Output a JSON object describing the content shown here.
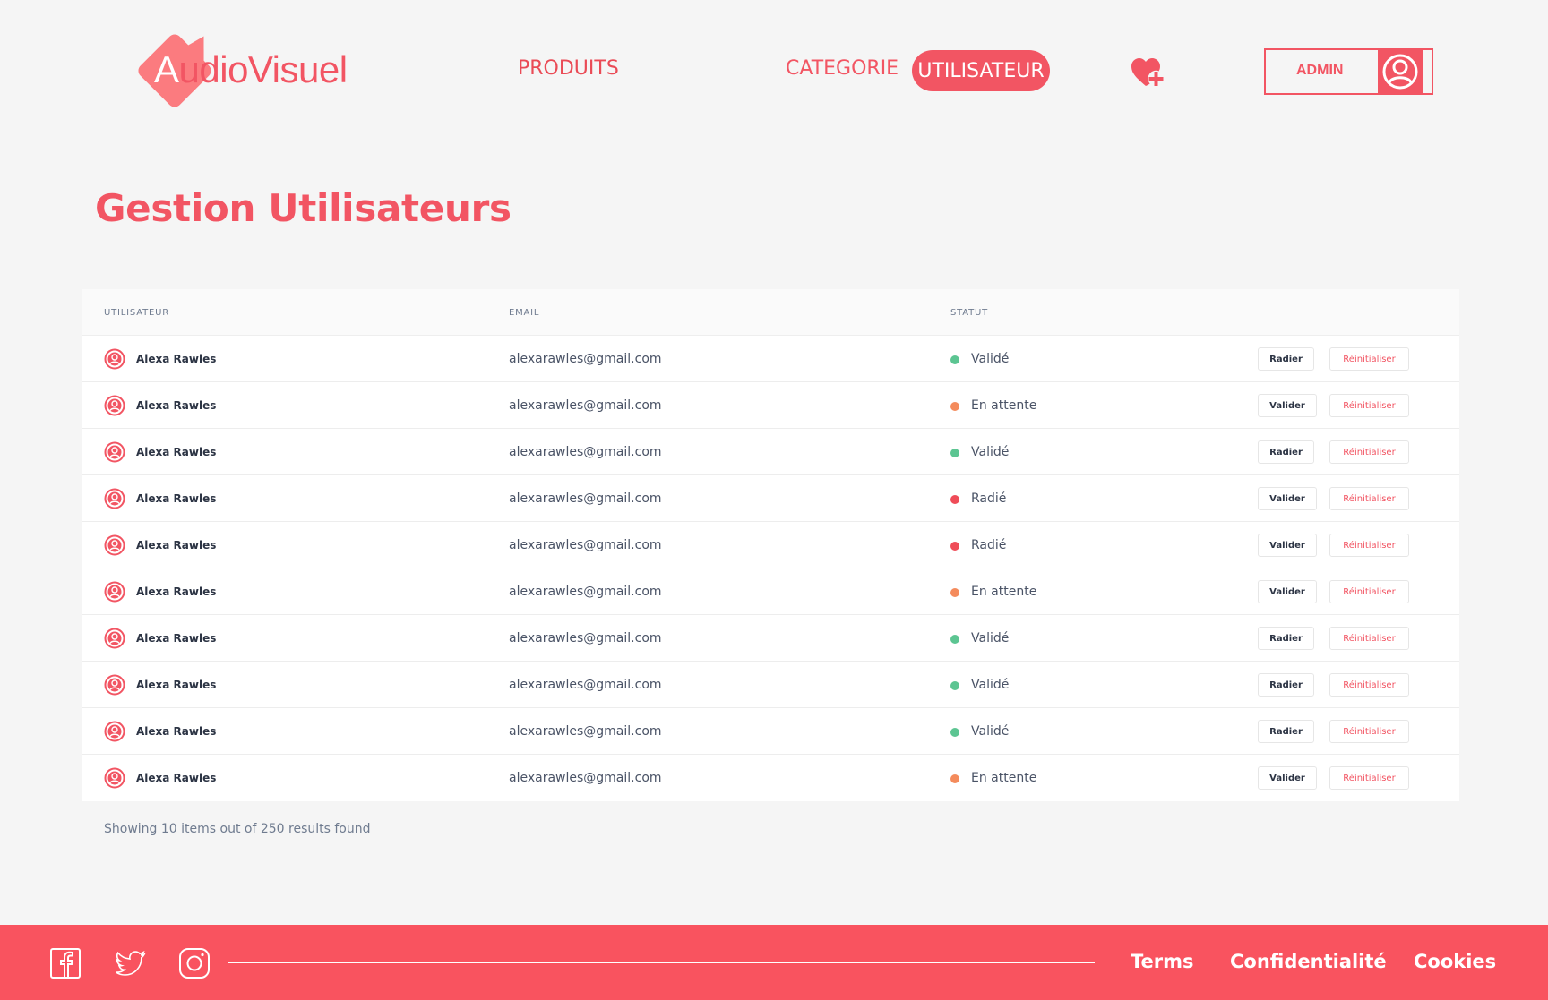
{
  "brand": {
    "logo_first": "A",
    "logo_rest": "udioVisuel"
  },
  "nav": {
    "produits": "PRODUITS",
    "categorie": "CATEGORIE",
    "utilisateur": "UTILISATEUR"
  },
  "header": {
    "favorite_icon": "heart-plus-icon",
    "admin_label": "ADMIN",
    "avatar_icon": "user-circle-icon"
  },
  "page": {
    "title": "Gestion Utilisateurs"
  },
  "table": {
    "columns": {
      "user": "UTILISATEUR",
      "email": "EMAIL",
      "status": "STATUT"
    },
    "rows": [
      {
        "name": "Alexa Rawles",
        "email": "alexarawles@gmail.com",
        "status": "Validé",
        "status_color": "#5cc592",
        "action": "Radier",
        "reset": "Réinitialiser"
      },
      {
        "name": "Alexa Rawles",
        "email": "alexarawles@gmail.com",
        "status": "En attente",
        "status_color": "#f48b5c",
        "action": "Valider",
        "reset": "Réinitialiser"
      },
      {
        "name": "Alexa Rawles",
        "email": "alexarawles@gmail.com",
        "status": "Validé",
        "status_color": "#5cc592",
        "action": "Radier",
        "reset": "Réinitialiser"
      },
      {
        "name": "Alexa Rawles",
        "email": "alexarawles@gmail.com",
        "status": "Radié",
        "status_color": "#ef4c58",
        "action": "Valider",
        "reset": "Réinitialiser"
      },
      {
        "name": "Alexa Rawles",
        "email": "alexarawles@gmail.com",
        "status": "Radié",
        "status_color": "#ef4c58",
        "action": "Valider",
        "reset": "Réinitialiser"
      },
      {
        "name": "Alexa Rawles",
        "email": "alexarawles@gmail.com",
        "status": "En attente",
        "status_color": "#f48b5c",
        "action": "Valider",
        "reset": "Réinitialiser"
      },
      {
        "name": "Alexa Rawles",
        "email": "alexarawles@gmail.com",
        "status": "Validé",
        "status_color": "#5cc592",
        "action": "Radier",
        "reset": "Réinitialiser"
      },
      {
        "name": "Alexa Rawles",
        "email": "alexarawles@gmail.com",
        "status": "Validé",
        "status_color": "#5cc592",
        "action": "Radier",
        "reset": "Réinitialiser"
      },
      {
        "name": "Alexa Rawles",
        "email": "alexarawles@gmail.com",
        "status": "Validé",
        "status_color": "#5cc592",
        "action": "Radier",
        "reset": "Réinitialiser"
      },
      {
        "name": "Alexa Rawles",
        "email": "alexarawles@gmail.com",
        "status": "En attente",
        "status_color": "#f48b5c",
        "action": "Valider",
        "reset": "Réinitialiser"
      }
    ],
    "summary": "Showing 10 items out of 250 results found"
  },
  "footer": {
    "social_icons": [
      "facebook-icon",
      "twitter-icon",
      "instagram-icon"
    ],
    "links": {
      "terms": "Terms",
      "privacy": "Confidentialité",
      "cookies": "Cookies"
    }
  },
  "colors": {
    "accent": "#f25563",
    "footer_bg": "#f9535f",
    "page_bg": "#f5f5f5"
  }
}
